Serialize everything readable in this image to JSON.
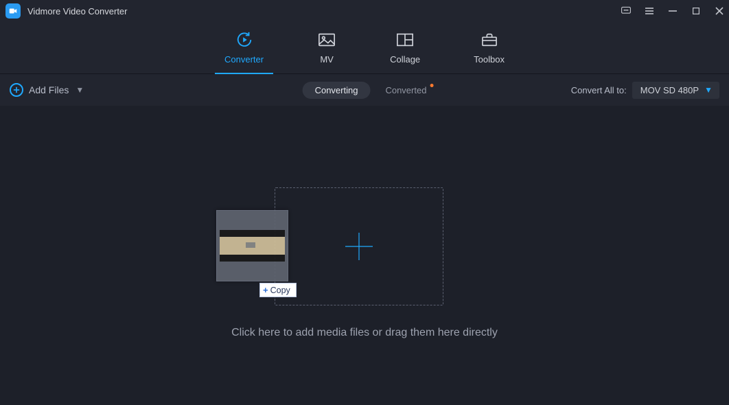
{
  "app": {
    "title": "Vidmore Video Converter"
  },
  "nav": {
    "converter": "Converter",
    "mv": "MV",
    "collage": "Collage",
    "toolbox": "Toolbox"
  },
  "subbar": {
    "add_files": "Add Files",
    "converting": "Converting",
    "converted": "Converted",
    "convert_all_to": "Convert All to:",
    "format_selected": "MOV SD 480P"
  },
  "dropzone": {
    "instruction": "Click here to add media files or drag them here directly"
  },
  "drag": {
    "copy_label": "Copy"
  }
}
